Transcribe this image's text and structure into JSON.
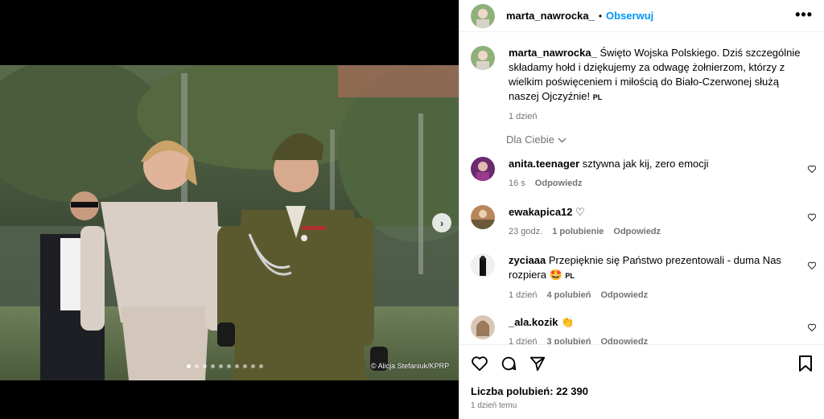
{
  "media": {
    "credit": "© Alicja Stefaniuk/KPRP",
    "next_icon": "chevron-right-icon",
    "dots_total": 10,
    "dots_active": 1
  },
  "header": {
    "username": "marta_nawrocka_",
    "separator": "•",
    "follow_label": "Obserwuj",
    "more_icon": "more-horizontal-icon"
  },
  "caption": {
    "username": "marta_nawrocka_",
    "text": "Święto Wojska Polskiego. Dziś szczególnie składamy hołd i dziękujemy za odwagę żołnierzom, którzy z wielkim poświęceniem i miłością do Biało-Czerwonej służą naszej Ojczyźnie!",
    "lang": "PL",
    "time": "1 dzień"
  },
  "sort": {
    "label": "Dla Ciebie"
  },
  "comments": [
    {
      "username": "anita.teenager",
      "text": "sztywna jak kij, zero emocji",
      "time": "16 s",
      "likes": "",
      "reply": "Odpowiedz"
    },
    {
      "username": "ewakapica12",
      "text": "♡",
      "time": "23 godz.",
      "likes": "1 polubienie",
      "reply": "Odpowiedz"
    },
    {
      "username": "zyciaaa",
      "text": "Przepięknie się Państwo prezentowali - duma Nas rozpiera 🤩",
      "lang": "PL",
      "time": "1 dzień",
      "likes": "4 polubień",
      "reply": "Odpowiedz"
    },
    {
      "username": "_ala.kozik",
      "text": "👏",
      "time": "1 dzień",
      "likes": "3 polubień",
      "reply": "Odpowiedz"
    }
  ],
  "actions": {
    "likes_label": "Liczba polubień: 22 390",
    "posted": "1 dzień temu"
  },
  "colors": {
    "accent": "#0095f6",
    "muted": "#737373"
  }
}
